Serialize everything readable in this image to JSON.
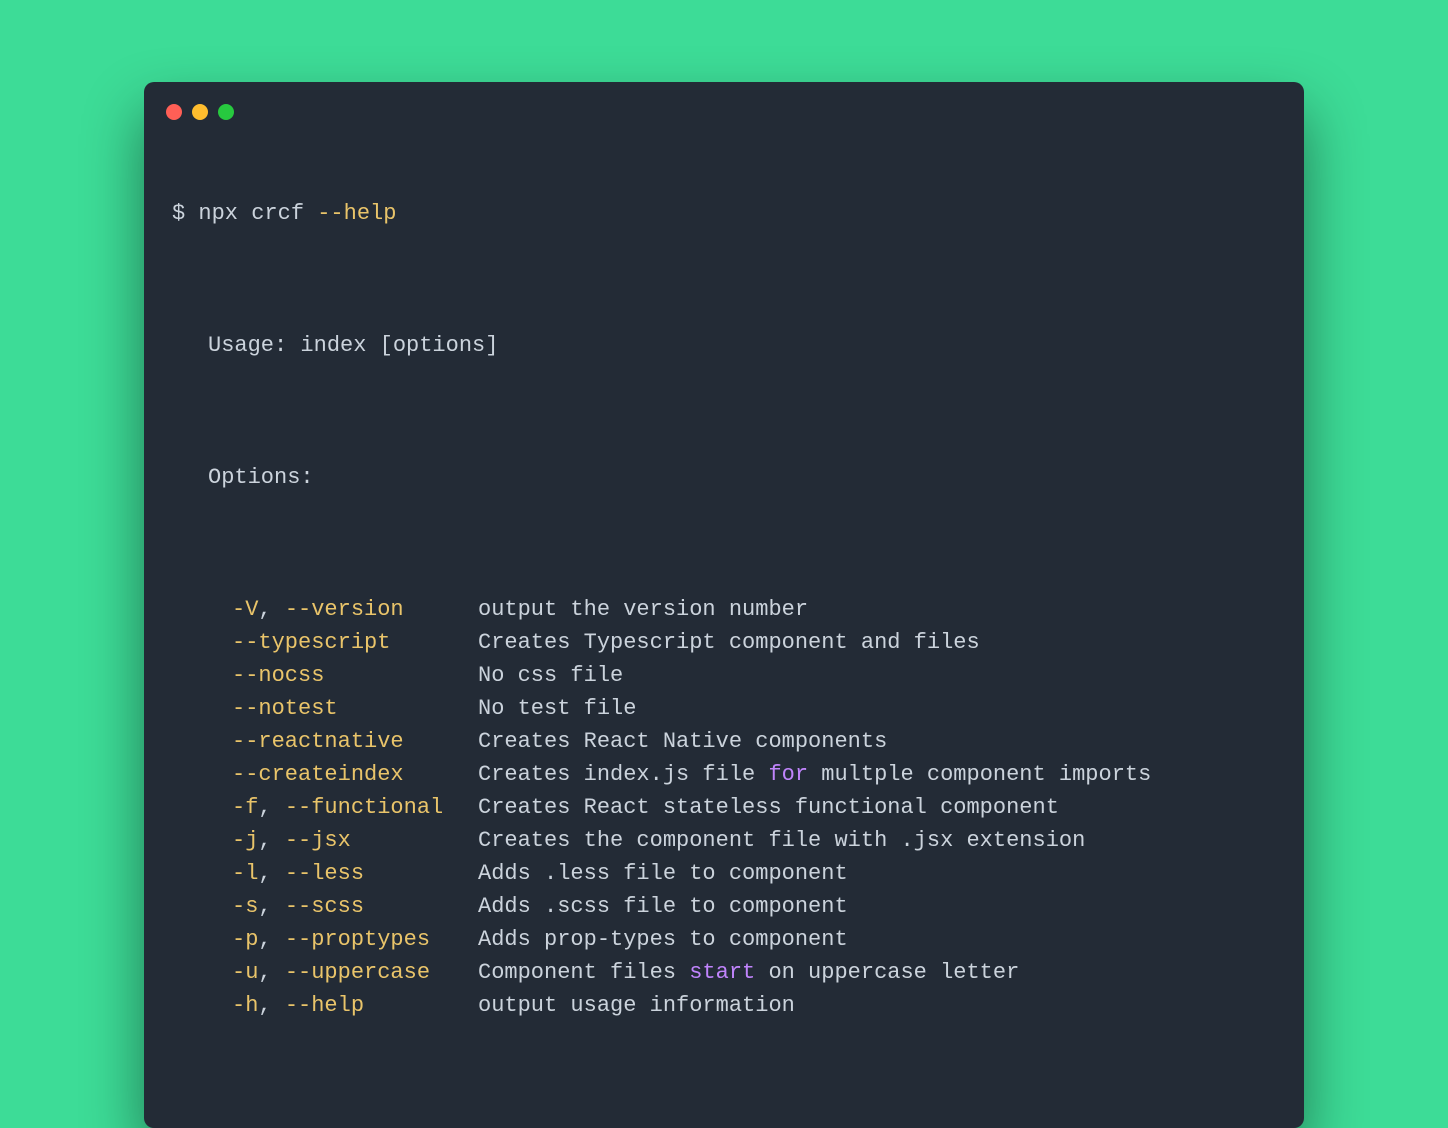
{
  "prompt": {
    "symbol": "$",
    "command": "npx crcf",
    "flag": "--help"
  },
  "usage_line": "Usage: index [options]",
  "options_header": "Options:",
  "options": [
    {
      "short": "-V",
      "long": "--version",
      "desc": "output the version number"
    },
    {
      "short": "",
      "long": "--typescript",
      "desc": "Creates Typescript component and files"
    },
    {
      "short": "",
      "long": "--nocss",
      "desc": "No css file"
    },
    {
      "short": "",
      "long": "--notest",
      "desc": "No test file"
    },
    {
      "short": "",
      "long": "--reactnative",
      "desc": "Creates React Native components"
    },
    {
      "short": "",
      "long": "--createindex",
      "desc_pre": "Creates index.js file ",
      "keyword": "for",
      "desc_post": " multple component imports"
    },
    {
      "short": "-f",
      "long": "--functional",
      "desc": "Creates React stateless functional component"
    },
    {
      "short": "-j",
      "long": "--jsx",
      "desc": "Creates the component file with .jsx extension"
    },
    {
      "short": "-l",
      "long": "--less",
      "desc": "Adds .less file to component"
    },
    {
      "short": "-s",
      "long": "--scss",
      "desc": "Adds .scss file to component"
    },
    {
      "short": "-p",
      "long": "--proptypes",
      "desc": "Adds prop-types to component"
    },
    {
      "short": "-u",
      "long": "--uppercase",
      "desc_pre": "Component files ",
      "keyword": "start",
      "desc_post": " on uppercase letter"
    },
    {
      "short": "-h",
      "long": "--help",
      "desc": "output usage information"
    }
  ]
}
